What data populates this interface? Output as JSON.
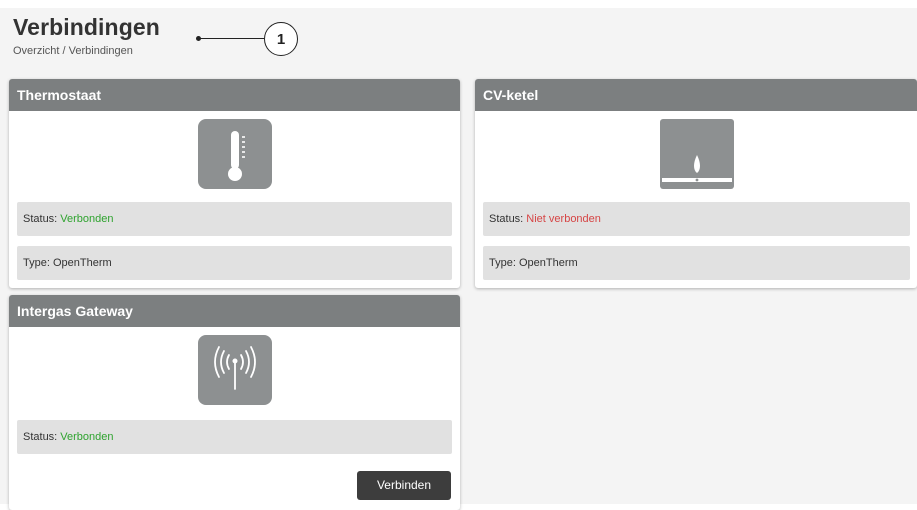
{
  "header": {
    "title": "Verbindingen",
    "breadcrumb": "Overzicht / Verbindingen",
    "callout_number": "1"
  },
  "cards": {
    "thermostaat": {
      "title": "Thermostaat",
      "icon": "thermometer-icon",
      "status_label": "Status: ",
      "status_value": "Verbonden",
      "type_text": "Type: OpenTherm"
    },
    "cv_ketel": {
      "title": "CV-ketel",
      "icon": "boiler-flame-icon",
      "status_label": "Status: ",
      "status_value": "Niet verbonden",
      "type_text": "Type: OpenTherm"
    },
    "gateway": {
      "title": "Intergas Gateway",
      "icon": "antenna-signal-icon",
      "status_label": "Status: ",
      "status_value": "Verbonden",
      "button_label": "Verbinden"
    }
  },
  "colors": {
    "header_bar": "#7c7f80",
    "icon_bg": "#8d9091",
    "connected": "#2fa32f",
    "disconnected": "#d64545",
    "button": "#3d3d3d"
  }
}
